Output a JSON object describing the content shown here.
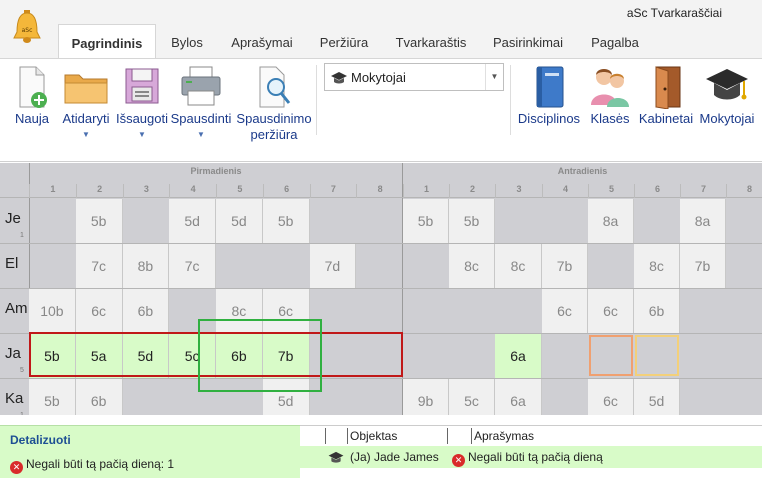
{
  "window": {
    "title": "aSc Tvarkaraščiai"
  },
  "tabs": [
    {
      "label": "Pagrindinis",
      "active": true
    },
    {
      "label": "Bylos"
    },
    {
      "label": "Aprašymai"
    },
    {
      "label": "Peržiūra"
    },
    {
      "label": "Tvarkaraštis"
    },
    {
      "label": "Pasirinkimai"
    },
    {
      "label": "Pagalba"
    }
  ],
  "ribbon": {
    "new_label": "Nauja",
    "open_label": "Atidaryti",
    "save_label": "Išsaugoti",
    "print_label": "Spausdinti",
    "preview_label_1": "Spausdinimo",
    "preview_label_2": "peržiūra",
    "view_select_value": "Mokytojai",
    "subjects_label": "Disciplinos",
    "classes_label": "Klasės",
    "rooms_label": "Kabinetai",
    "teachers_label": "Mokytojai"
  },
  "grid": {
    "days": [
      {
        "name": "Pirmadienis",
        "periods": [
          "1",
          "2",
          "3",
          "4",
          "5",
          "6",
          "7",
          "8"
        ]
      },
      {
        "name": "Antradienis",
        "periods": [
          "1",
          "2",
          "3",
          "4",
          "5",
          "6",
          "7",
          "8"
        ]
      }
    ],
    "rows": [
      {
        "label": "Je",
        "sub": "1",
        "cells": [
          "",
          "5b",
          "",
          "5d",
          "5d",
          "5b",
          "",
          "",
          "5b",
          "5b",
          "",
          "",
          "8a",
          "",
          "8a",
          ""
        ]
      },
      {
        "label": "El",
        "sub": "",
        "cells": [
          "",
          "7c",
          "8b",
          "7c",
          "",
          "",
          "7d",
          "",
          "",
          "8c",
          "8c",
          "7b",
          "",
          "8c",
          "7b",
          ""
        ]
      },
      {
        "label": "Am",
        "sub": "",
        "cells": [
          "10b",
          "6c",
          "6b",
          "",
          "8c",
          "6c",
          "",
          "",
          "",
          "",
          "",
          "6c",
          "6c",
          "6b",
          "",
          ""
        ]
      },
      {
        "label": "Ja",
        "sub": "5",
        "cells": [
          "5b",
          "5a",
          "5d",
          "5c",
          "6b",
          "7b",
          "",
          "",
          "",
          "",
          "6a",
          "",
          "",
          "",
          "",
          ""
        ]
      },
      {
        "label": "Ka",
        "sub": "1",
        "cells": [
          "5b",
          "6b",
          "",
          "",
          "",
          "5d",
          "",
          "",
          "9b",
          "5c",
          "6a",
          "",
          "6c",
          "5d",
          "",
          ""
        ]
      }
    ]
  },
  "detail": {
    "title": "Detalizuoti",
    "message": "Negali būti tą pačią dieną: 1"
  },
  "messages": {
    "col_object": "Objektas",
    "col_description": "Aprašymas",
    "rows": [
      {
        "object": "(Ja) Jade James",
        "description": "Negali būti tą pačią dieną"
      }
    ]
  },
  "colors": {
    "highlight": "#d8fbc8",
    "conflict": "#c01818",
    "accent": "#1d4f94"
  }
}
